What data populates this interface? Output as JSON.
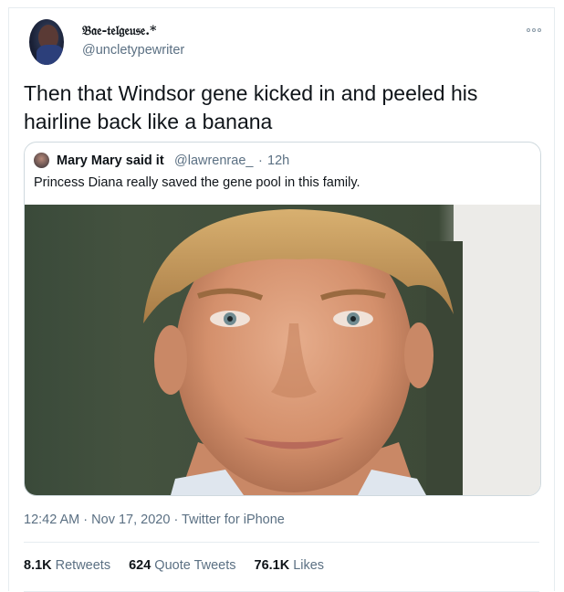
{
  "author": {
    "display_name": "𝔅𝔞𝔢-𝔱𝔢𝔩𝔤𝔢𝔲𝔰𝔢.*",
    "handle": "@uncletypewriter",
    "avatar_icon": "profile-avatar"
  },
  "tweet": {
    "text": "Then that Windsor gene kicked in and peeled his hairline back like a banana"
  },
  "quoted": {
    "name": "Mary Mary said it",
    "handle": "@lawrenrae_",
    "separator": "·",
    "time": "12h",
    "text": "Princess Diana really saved the gene pool in this family."
  },
  "meta": {
    "time": "12:42 AM",
    "sep1": " · ",
    "date": "Nov 17, 2020",
    "sep2": " · ",
    "client": "Twitter for iPhone"
  },
  "stats": {
    "retweets_count": "8.1K",
    "retweets_label": "Retweets",
    "quotes_count": "624",
    "quotes_label": "Quote Tweets",
    "likes_count": "76.1K",
    "likes_label": "Likes"
  },
  "colors": {
    "text_primary": "#0f1419",
    "text_secondary": "#5b7083",
    "border": "#cfd9de"
  }
}
